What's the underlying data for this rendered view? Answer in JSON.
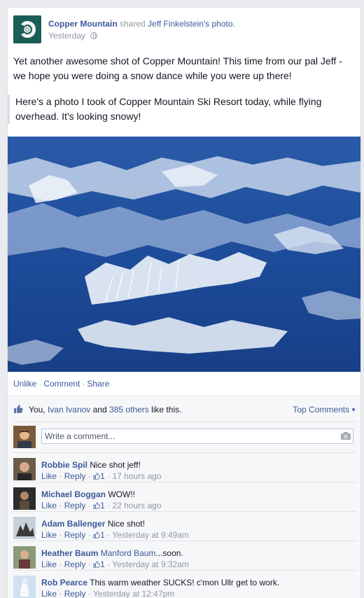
{
  "post": {
    "page_name": "Copper Mountain",
    "shared_text": "shared",
    "shared_author": "Jeff Finkelstein",
    "shared_suffix": "'s photo.",
    "time": "Yesterday",
    "text": "Yet another awesome shot of Copper Mountain! This time from our pal Jeff - we hope you were doing a snow dance while you were up there!",
    "quote": "Here's a photo I took of Copper Mountain Ski Resort today, while flying overhead. It's looking snowy!"
  },
  "actions": {
    "unlike": "Unlike",
    "comment": "Comment",
    "share": "Share"
  },
  "likes": {
    "you": "You,",
    "friend": "Ivan Ivanov",
    "and": "and",
    "others": "385 others",
    "suffix": "like this.",
    "top_comments": "Top Comments"
  },
  "composer": {
    "placeholder": "Write a comment..."
  },
  "comment_labels": {
    "like": "Like",
    "reply": "Reply",
    "separator": "·"
  },
  "comments": [
    {
      "name": "Robbie Spil",
      "text": "Nice shot jeff!",
      "likes": "1",
      "time": "17 hours ago"
    },
    {
      "name": "Michael Boggan",
      "text": "WOW!!",
      "likes": "1",
      "time": "22 hours ago"
    },
    {
      "name": "Adam Ballenger",
      "text": "Nice shot!",
      "likes": "1",
      "time": "Yesterday at 9:49am"
    },
    {
      "name": "Heather Baum",
      "mention": "Manford Baum",
      "text": "...soon.",
      "likes": "1",
      "time": "Yesterday at 9:32am"
    },
    {
      "name": "Rob Pearce",
      "text": "This warm weather SUCKS! c'mon Ullr get to work.",
      "time": "Yesterday at 12:47pm"
    }
  ],
  "colors": {
    "link": "#3b5998",
    "muted": "#9197a3",
    "brand_avatar": "#1b5e58",
    "photo_sky": "#1f4d9e"
  },
  "icons": [
    "copper-mountain-logo-icon",
    "globe-icon",
    "thumbs-up-icon",
    "camera-icon"
  ]
}
